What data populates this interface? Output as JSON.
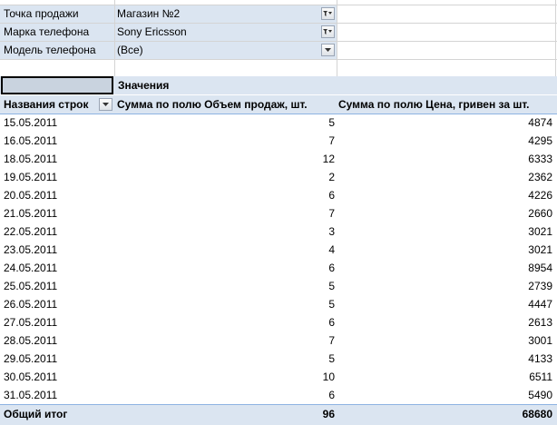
{
  "filters": [
    {
      "label": "Точка продажи",
      "value": "Магазин №2",
      "filtered": true
    },
    {
      "label": "Марка телефона",
      "value": "Sony Ericsson",
      "filtered": true
    },
    {
      "label": "Модель телефона",
      "value": "(Все)",
      "filtered": false
    }
  ],
  "pivot": {
    "values_caption": "Значения",
    "row_header": "Названия строк",
    "col1_header": "Сумма по полю Объем продаж, шт.",
    "col2_header": "Сумма по полю Цена, гривен за шт.",
    "rows": [
      {
        "date": "15.05.2011",
        "qty": "5",
        "price": "4874"
      },
      {
        "date": "16.05.2011",
        "qty": "7",
        "price": "4295"
      },
      {
        "date": "18.05.2011",
        "qty": "12",
        "price": "6333"
      },
      {
        "date": "19.05.2011",
        "qty": "2",
        "price": "2362"
      },
      {
        "date": "20.05.2011",
        "qty": "6",
        "price": "4226"
      },
      {
        "date": "21.05.2011",
        "qty": "7",
        "price": "2660"
      },
      {
        "date": "22.05.2011",
        "qty": "3",
        "price": "3021"
      },
      {
        "date": "23.05.2011",
        "qty": "4",
        "price": "3021"
      },
      {
        "date": "24.05.2011",
        "qty": "6",
        "price": "8954"
      },
      {
        "date": "25.05.2011",
        "qty": "5",
        "price": "2739"
      },
      {
        "date": "26.05.2011",
        "qty": "5",
        "price": "4447"
      },
      {
        "date": "27.05.2011",
        "qty": "6",
        "price": "2613"
      },
      {
        "date": "28.05.2011",
        "qty": "7",
        "price": "3001"
      },
      {
        "date": "29.05.2011",
        "qty": "5",
        "price": "4133"
      },
      {
        "date": "30.05.2011",
        "qty": "10",
        "price": "6511"
      },
      {
        "date": "31.05.2011",
        "qty": "6",
        "price": "5490"
      }
    ],
    "total": {
      "label": "Общий итог",
      "qty": "96",
      "price": "68680"
    }
  },
  "colors": {
    "header_band": "#dbe5f1",
    "accent_line": "#8db3e2",
    "gridline": "#d4d4d4"
  },
  "icons": {
    "filtered_dropdown": "filter-funnel-icon",
    "plain_dropdown": "chevron-down-icon"
  }
}
